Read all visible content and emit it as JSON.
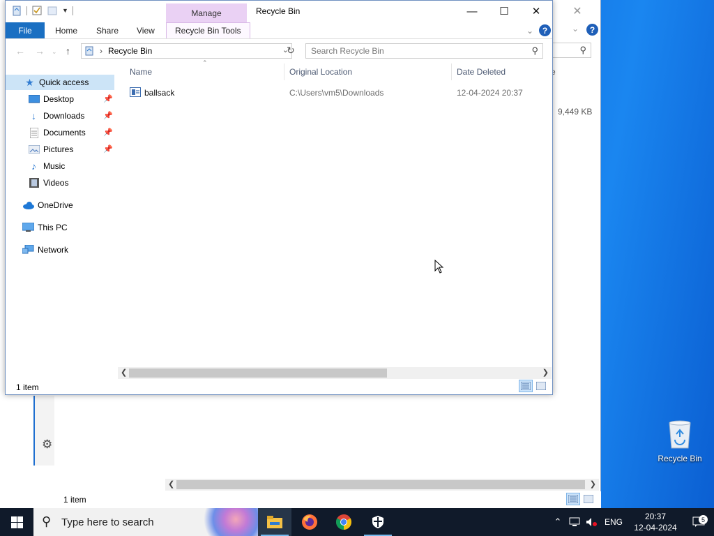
{
  "background_window": {
    "column_fragment": "e",
    "size_value": "9,449 KB",
    "status": "1 item"
  },
  "window": {
    "title": "Recycle Bin",
    "context_tab_group": "Manage",
    "ribbon_tabs": [
      "File",
      "Home",
      "Share",
      "View",
      "Recycle Bin Tools"
    ],
    "address_path": "Recycle Bin",
    "search_placeholder": "Search Recycle Bin",
    "status": "1 item"
  },
  "nav": {
    "quick_access": "Quick access",
    "pinned": [
      {
        "label": "Desktop",
        "icon": "desktop-folder-icon"
      },
      {
        "label": "Downloads",
        "icon": "downloads-folder-icon"
      },
      {
        "label": "Documents",
        "icon": "documents-folder-icon"
      },
      {
        "label": "Pictures",
        "icon": "pictures-folder-icon"
      }
    ],
    "others": [
      {
        "label": "Music",
        "icon": "music-folder-icon"
      },
      {
        "label": "Videos",
        "icon": "videos-folder-icon"
      }
    ],
    "onedrive": "OneDrive",
    "this_pc": "This PC",
    "network": "Network"
  },
  "table": {
    "columns": [
      "Name",
      "Original Location",
      "Date Deleted"
    ],
    "rows": [
      {
        "name": "ballsack",
        "location": "C:\\Users\\vm5\\Downloads",
        "date": "12-04-2024 20:37"
      }
    ]
  },
  "desktop": {
    "recycle_bin_label": "Recycle Bin"
  },
  "taskbar": {
    "search_placeholder": "Type here to search",
    "apps": [
      "file-explorer-icon",
      "firefox-icon",
      "chrome-icon",
      "security-shield-icon"
    ],
    "language": "ENG",
    "time": "20:37",
    "date": "12-04-2024",
    "notification_count": "5"
  },
  "colors": {
    "file_tab": "#1a6fc2",
    "manage_tab": "#ead1f4",
    "selected_nav": "#cce4f7",
    "taskbar": "#101a2a"
  }
}
